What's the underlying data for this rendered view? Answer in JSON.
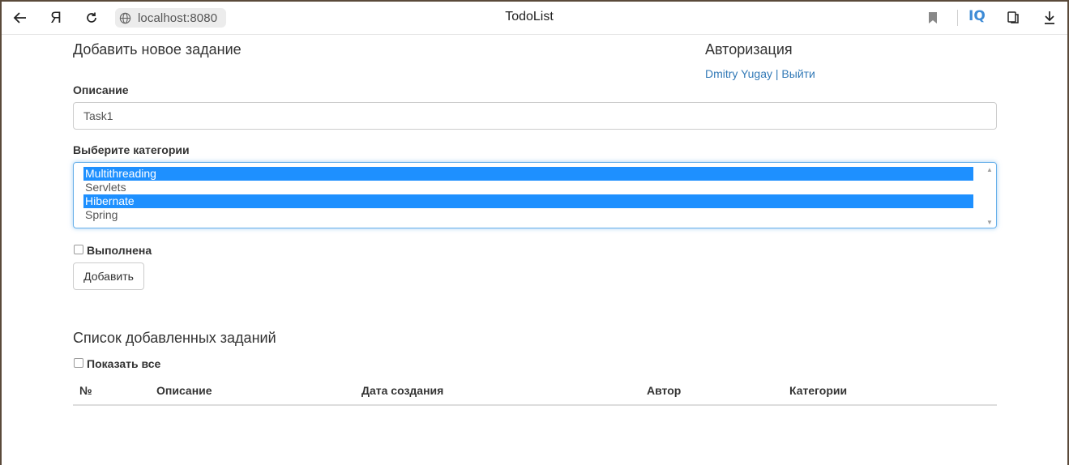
{
  "browser": {
    "url": "localhost:8080",
    "tab_title": "TodoList",
    "ya_glyph": "Я",
    "iq_badge": "IQ"
  },
  "form": {
    "heading": "Добавить новое задание",
    "description_label": "Описание",
    "description_value": "Task1",
    "categories_label": "Выберите категории",
    "categories": [
      {
        "label": "Multithreading",
        "selected": true
      },
      {
        "label": "Servlets",
        "selected": false
      },
      {
        "label": "Hibernate",
        "selected": true
      },
      {
        "label": "Spring",
        "selected": false
      }
    ],
    "done_label": "Выполнена",
    "add_button": "Добавить"
  },
  "auth": {
    "heading": "Авторизация",
    "user_name": "Dmitry Yugay",
    "separator": " | ",
    "logout": "Выйти"
  },
  "list": {
    "heading": "Список добавленных заданий",
    "show_all_label": "Показать все",
    "columns": [
      "№",
      "Описание",
      "Дата создания",
      "Автор",
      "Категории"
    ]
  },
  "colors": {
    "link": "#337ab7",
    "selected_option": "#1e90ff",
    "focus_border": "#66afe9"
  }
}
